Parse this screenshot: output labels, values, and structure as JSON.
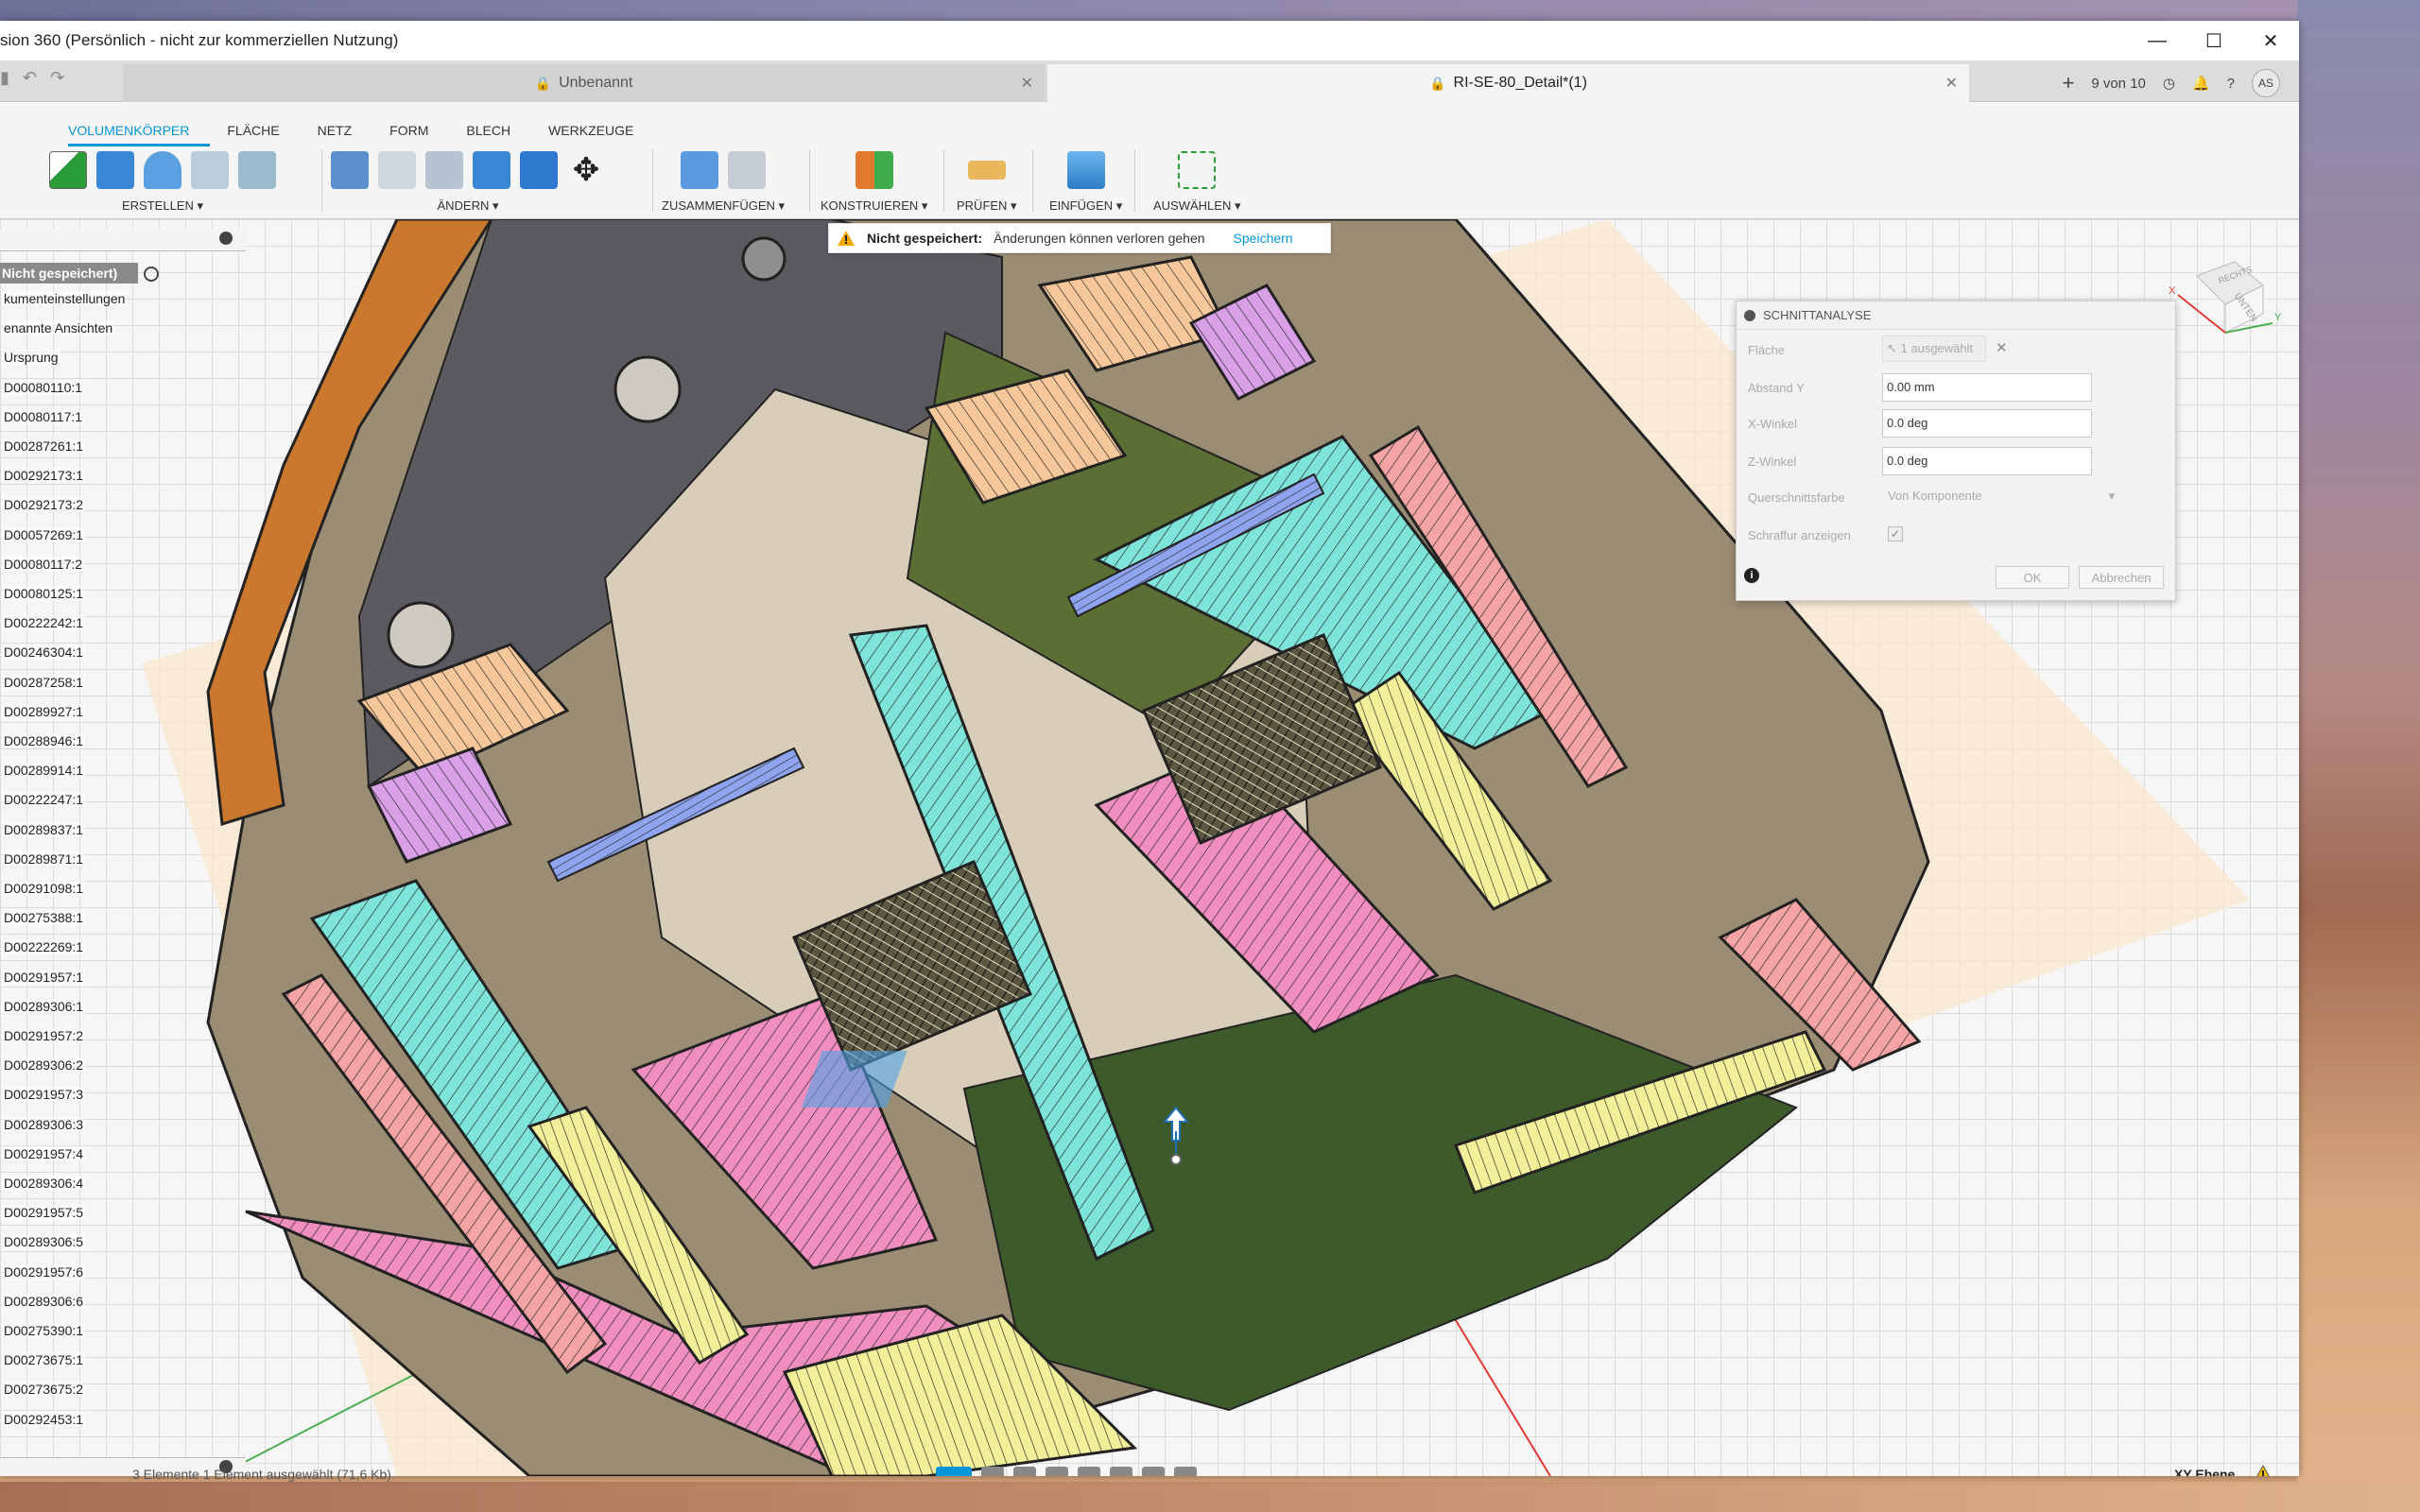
{
  "window": {
    "title": "sion 360 (Persönlich - nicht zur kommerziellen Nutzung)",
    "controls": [
      "—",
      "☐",
      "✕"
    ]
  },
  "tabs": {
    "inactive": "Unbenannt",
    "active": "RI-SE-80_Detail*(1)",
    "counter": "9 von 10",
    "avatar": "AS"
  },
  "ribbon": {
    "tabs": [
      "VOLUMENKÖRPER",
      "FLÄCHE",
      "NETZ",
      "FORM",
      "BLECH",
      "WERKZEUGE"
    ],
    "groups": [
      "ERSTELLEN ▾",
      "ÄNDERN ▾",
      "ZUSAMMENFÜGEN ▾",
      "KONSTRUIEREN ▾",
      "PRÜFEN ▾",
      "EINFÜGEN ▾",
      "AUSWÄHLEN ▾"
    ]
  },
  "warning": {
    "title": "Nicht gespeichert:",
    "message": "Änderungen können verloren gehen",
    "action": "Speichern"
  },
  "browser": {
    "root": "Nicht gespeichert)",
    "items": [
      "kumenteinstellungen",
      "enannte Ansichten",
      "Ursprung",
      "D00080110:1",
      "D00080117:1",
      "D00287261:1",
      "D00292173:1",
      "D00292173:2",
      "D00057269:1",
      "D00080117:2",
      "D00080125:1",
      "D00222242:1",
      "D00246304:1",
      "D00287258:1",
      "D00289927:1",
      "D00288946:1",
      "D00289914:1",
      "D00222247:1",
      "D00289837:1",
      "D00289871:1",
      "D00291098:1",
      "D00275388:1",
      "D00222269:1",
      "D00291957:1",
      "D00289306:1",
      "D00291957:2",
      "D00289306:2",
      "D00291957:3",
      "D00289306:3",
      "D00291957:4",
      "D00289306:4",
      "D00291957:5",
      "D00289306:5",
      "D00291957:6",
      "D00289306:6",
      "D00275390:1",
      "D00273675:1",
      "D00273675:2",
      "D00292453:1"
    ]
  },
  "dialog": {
    "title": "SCHNITTANALYSE",
    "labels": {
      "face": "Fläche",
      "offset": "Abstand Y",
      "xangle": "X-Winkel",
      "zangle": "Z-Winkel",
      "color": "Querschnittsfarbe",
      "hatch": "Schraffur anzeigen"
    },
    "values": {
      "face": "1 ausgewählt",
      "offset": "0.00 mm",
      "xangle": "0.0 deg",
      "zangle": "0.0 deg",
      "color": "Von Komponente"
    },
    "ok": "OK",
    "cancel": "Abbrechen"
  },
  "viewcube": {
    "right": "RECHTS",
    "bottom": "UNTEN",
    "x": "X",
    "y": "Y"
  },
  "status": {
    "left": "3 Elemente     1 Element ausgewählt (71,6 Kb)",
    "plane": "XY Ebene"
  },
  "colors": {
    "accent": "#0696d7",
    "pink": "#f08fbf",
    "cyan": "#7ee3d8",
    "yellow": "#f2ef9a",
    "salmon": "#f4a4a4",
    "peach": "#f6c79a",
    "violet": "#d9a0e8",
    "blue": "#8fa4ee",
    "olive": "#5b6e34",
    "orange": "#c9782e"
  }
}
